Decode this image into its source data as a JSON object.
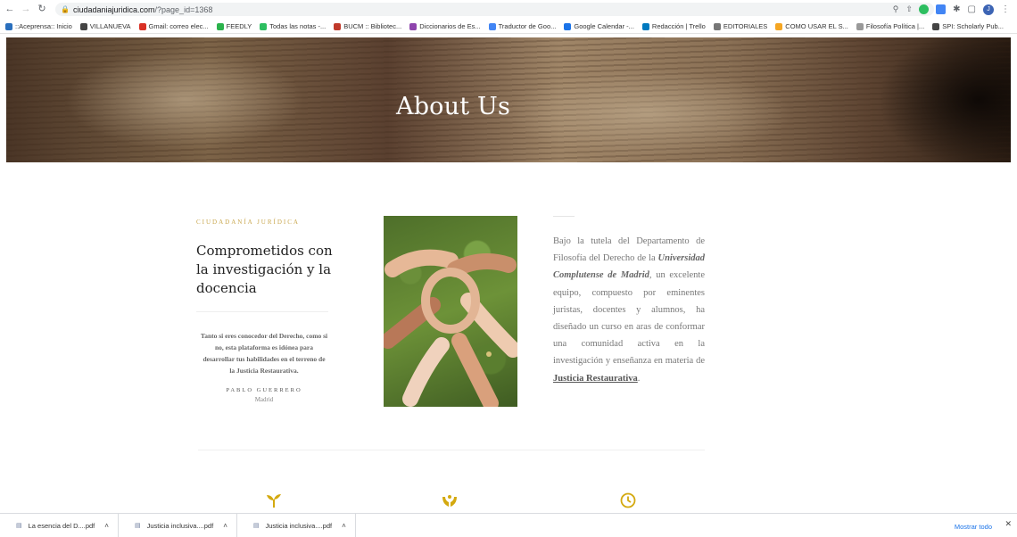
{
  "browser": {
    "url_host": "ciudadaniajuridica.com",
    "url_path": "/?page_id=1368",
    "profile_initial": "J"
  },
  "bookmarks": [
    {
      "label": "::Aceprensa:: Inicio",
      "color": "#2a6fbd"
    },
    {
      "label": "VILLANUEVA",
      "color": "#444444"
    },
    {
      "label": "Gmail: correo elec...",
      "color": "#d93025"
    },
    {
      "label": "FEEDLY",
      "color": "#2bb24c"
    },
    {
      "label": "Todas las notas -...",
      "color": "#2dbe60"
    },
    {
      "label": "BUCM :: Bibliotec...",
      "color": "#c0392b"
    },
    {
      "label": "Diccionarios de Es...",
      "color": "#8e44ad"
    },
    {
      "label": "Traductor de Goo...",
      "color": "#4285f4"
    },
    {
      "label": "Google Calendar -...",
      "color": "#1a73e8"
    },
    {
      "label": "Redacción | Trello",
      "color": "#0079bf"
    },
    {
      "label": "EDITORIALES",
      "color": "#777777"
    },
    {
      "label": "COMO USAR EL S...",
      "color": "#f5a623"
    },
    {
      "label": "Filosofía Política |...",
      "color": "#999999"
    },
    {
      "label": "SPI: Scholarly Pub...",
      "color": "#444444"
    }
  ],
  "hero": {
    "title": "About Us"
  },
  "about": {
    "kicker": "CIUDADANÍA JURÍDICA",
    "heading": "Comprometidos con la investigación y la docencia",
    "quote": "Tanto si eres conocedor del Derecho, como si no, esta plataforma es idónea para desarrollar tus habilidades en el terreno de la Justicia Restaurativa.",
    "author": "PABLO GUERRERO",
    "place": "Madrid",
    "body_part1": "Bajo la tutela del Departamento de Filosofía del Derecho de la ",
    "body_strong": "Universidad Complutense de Madrid",
    "body_part2": ", un excelente equipo, compuesto por eminentes juristas, docentes y alumnos, ha diseñado un curso en aras de conformar una comunidad activa en la investigación y enseñanza en materia de ",
    "body_link": "Justicia Restaurativa",
    "body_end": "."
  },
  "theme": {
    "accent": "#c9a74e",
    "icon_color": "#d4a90f"
  },
  "downloads": {
    "items": [
      {
        "name": "La esencia del D....pdf"
      },
      {
        "name": "Justicia inclusiva....pdf"
      },
      {
        "name": "Justicia inclusiva....pdf"
      }
    ],
    "show_all": "Mostrar todo"
  }
}
